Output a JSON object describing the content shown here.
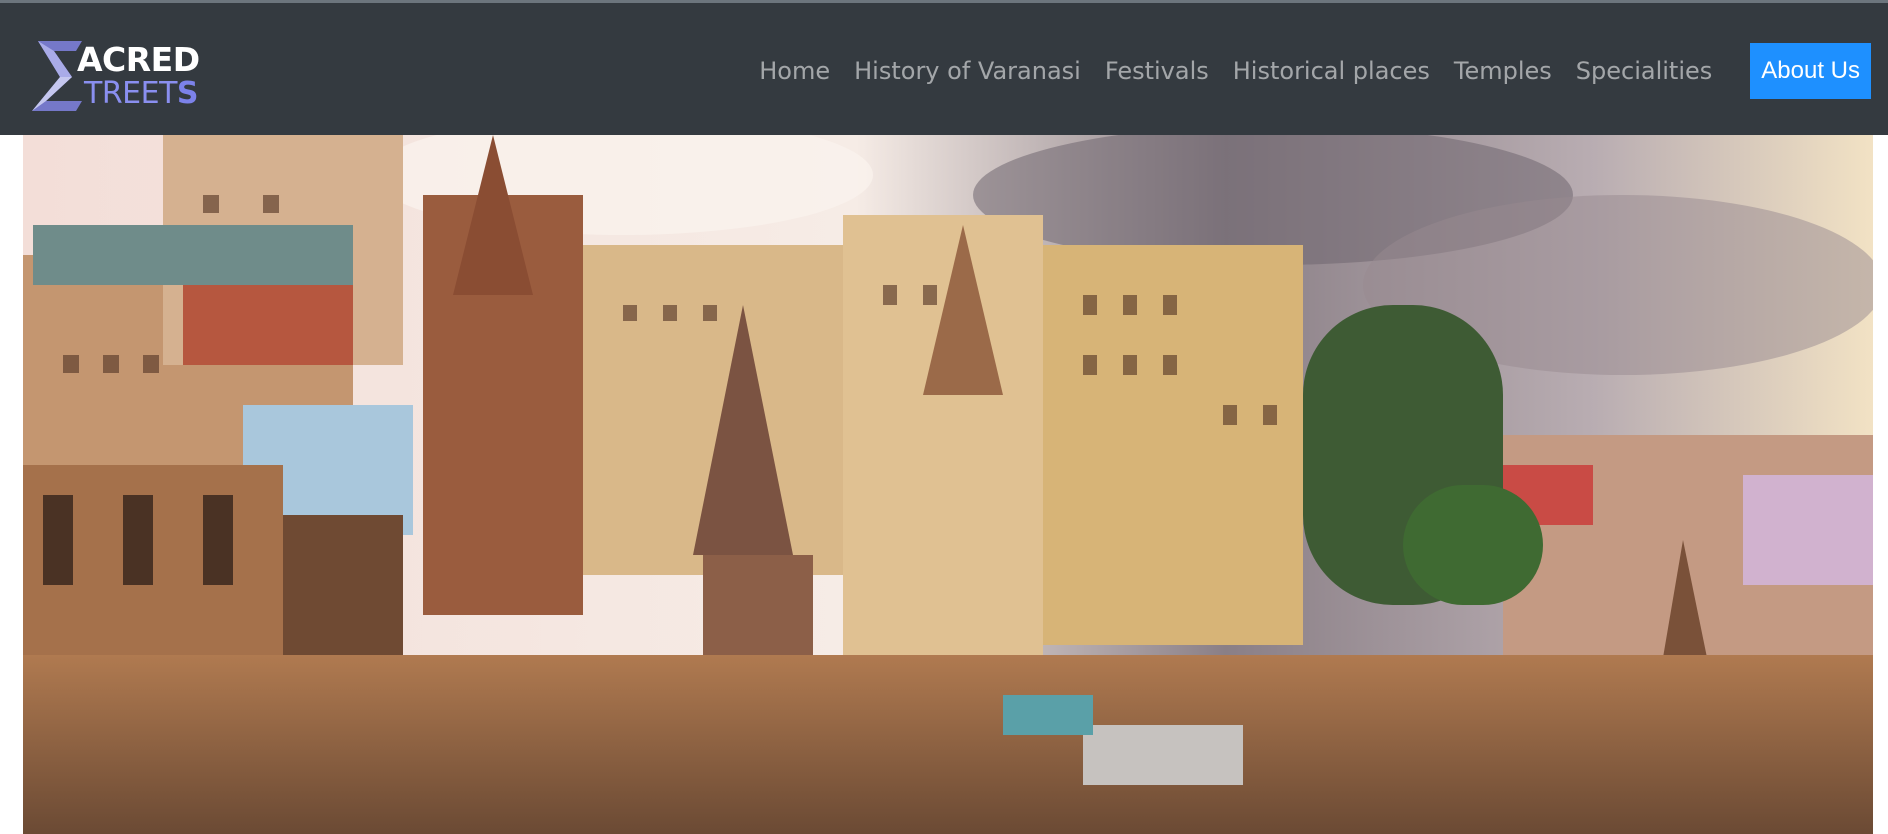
{
  "brand": {
    "top_text": "ACRED",
    "bottom_text": "TREET",
    "bottom_last": "S",
    "logo_icon": "stylized-s-logo-icon"
  },
  "nav": {
    "items": [
      {
        "label": "Home"
      },
      {
        "label": "History of Varanasi"
      },
      {
        "label": "Festivals"
      },
      {
        "label": "Historical places"
      },
      {
        "label": "Temples"
      },
      {
        "label": "Specialities"
      }
    ],
    "cta_label": "About Us"
  },
  "colors": {
    "navbar_bg": "#343a40",
    "nav_link": "#9a9ea2",
    "cta_bg": "#1e90ff",
    "brand_accent": "#8a8ff0"
  },
  "hero": {
    "image_description_icon": "varanasi-ghats-hero-image"
  }
}
